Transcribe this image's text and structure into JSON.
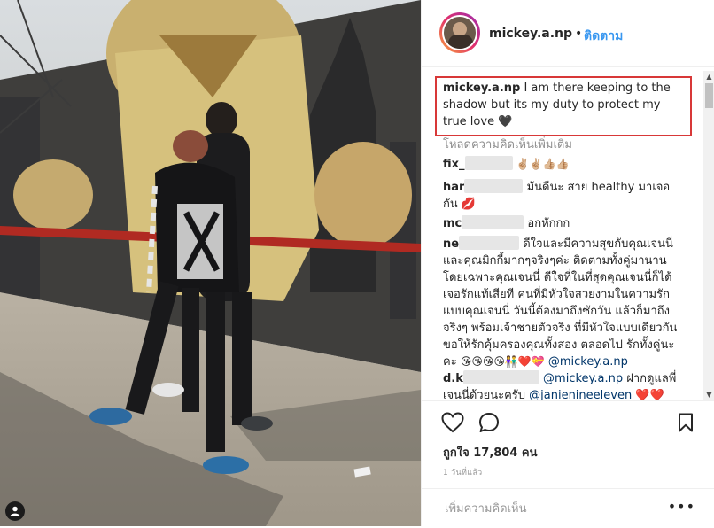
{
  "post": {
    "username": "mickey.a.np",
    "separator": "•",
    "follow_label": "ติดตาม",
    "more_label": "•••"
  },
  "caption": {
    "username": "mickey.a.np",
    "text": "I am there keeping to the shadow but its my duty to protect my true love 🖤"
  },
  "load_more_label": "โหลดความคิดเห็นเพิ่มเติม",
  "comments": [
    {
      "username": "fix_",
      "text": "✌🏼✌🏼👍🏼👍🏼"
    },
    {
      "username": "har",
      "text": "มันดีนะ สาย healthy มาเจอกัน 💋"
    },
    {
      "username": "mc",
      "text": "อกหักกก"
    },
    {
      "username": "ne",
      "text": "ดีใจและมีความสุขกับคุณเจนนี่และคุณมิกกี้มากๆจริงๆค่ะ ติดตามทั้งคู่มานานโดยเฉพาะคุณเจนนี่ ดีใจที่ในที่สุดคุณเจนนี่ก็ได้เจอรักแท้เสียที คนที่มีหัวใจสวยงามในความรักแบบคุณเจนนี่ วันนี้ต้องมาถึงซักวัน แล้วก็มาถึงจริงๆ พร้อมเจ้าชายตัวจริง ที่มีหัวใจแบบเดียวกันขอให้รักคุ้มครองคุณทั้งสอง ตลอดไป รักทั้งคู่นะคะ",
      "emojis": "😘😘😘😘👫❤️💝",
      "mention": "@mickey.a.np"
    },
    {
      "username": "d.k",
      "mention": "@mickey.a.np",
      "text": "ฝากดูแลพี่เจนนี่ด้วยนะครับ",
      "mention2": "@janienineeleven",
      "hearts": "❤️❤️"
    }
  ],
  "likes": "ถูกใจ 17,804 คน",
  "time_ago": "1 วันที่แล้ว",
  "add_comment": {
    "placeholder": "เพิ่มความคิดเห็น",
    "more_label": "•••"
  },
  "icons": {
    "like": "heart-outline-icon",
    "comment": "speech-bubble-icon",
    "save": "bookmark-icon",
    "user_tag": "person-icon"
  },
  "colors": {
    "follow": "#3897f0",
    "highlight_border": "#d83838",
    "heart": "#ed1c3c"
  }
}
